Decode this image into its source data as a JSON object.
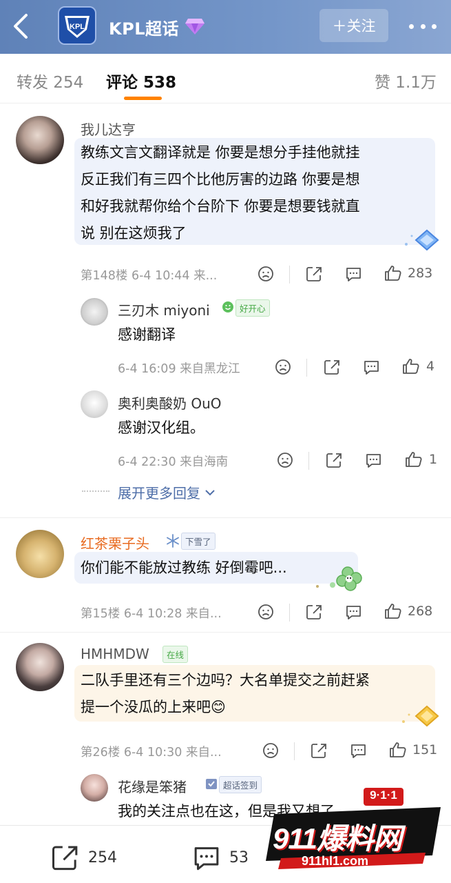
{
  "header": {
    "title": "KPL超话",
    "logo_text": "KPL",
    "follow_label": "＋关注",
    "icons": [
      "back-icon",
      "gem-icon",
      "more-icon"
    ]
  },
  "tabs": {
    "repost": "转发 254",
    "comments": "评论 538",
    "likes": "赞 1.1万"
  },
  "comments": [
    {
      "user": "我儿达亨",
      "lines": [
        "教练文言文翻译就是 你要是想分手挂他就挂",
        "反正我们有三四个比他厉害的边路 你要是想",
        "和好我就帮你给个台阶下 你要是想要钱就直",
        "说 别在这烦我了"
      ],
      "meta": "第148楼 6-4 10:44 来...",
      "likes": "283",
      "replies": [
        {
          "user": "三刃木 miyoni",
          "badge": "好开心",
          "text": "感谢翻译",
          "meta": "6-4 16:09 来自黑龙江",
          "likes": "4"
        },
        {
          "user": "奥利奥酸奶 OuO",
          "text": "感谢汉化组。",
          "meta": "6-4 22:30 来自海南",
          "likes": "1"
        }
      ],
      "expand": "展开更多回复"
    },
    {
      "user": "红茶栗子头",
      "user_color": "#e86a1f",
      "badge": "下雪了",
      "lines": [
        "你们能不能放过教练 好倒霉吧..."
      ],
      "meta": "第15楼 6-4 10:28 来自...",
      "likes": "268"
    },
    {
      "user": "HMHMDW",
      "badge": "在线",
      "lines": [
        "二队手里还有三个边吗？大名单提交之前赶紧",
        "提一个没瓜的上来吧"
      ],
      "emoji": "😊",
      "meta": "第26楼 6-4 10:30 来自...",
      "likes": "151",
      "replies": [
        {
          "user": "花缘是笨猪",
          "badge": "超话签到",
          "text": "我的关注点也在这，但是我又想了"
        }
      ]
    }
  ],
  "bottom": {
    "repost_count": "254",
    "comment_count": "53"
  },
  "watermark": {
    "top": "9·1·1",
    "main": "911爆料网",
    "url": "911hl1.com"
  },
  "colors": {
    "header": "#6b8fc4",
    "accent": "#ff8200",
    "bubble": "#eef2fb",
    "link": "#4e6ea8"
  }
}
